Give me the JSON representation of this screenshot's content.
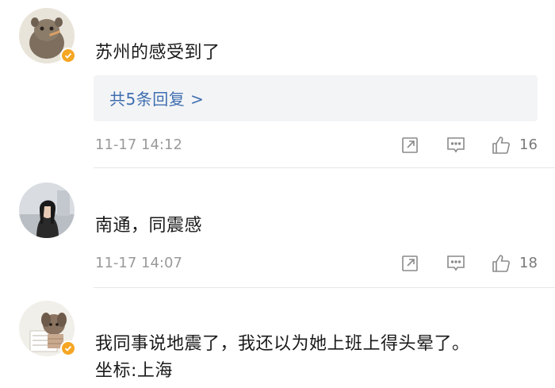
{
  "comments": [
    {
      "avatar_icon": "cartoon-animal-avatar",
      "verified_icon": "verified-badge-icon",
      "text": "苏州的感受到了",
      "reply_summary": "共5条回复 >",
      "time": "11-17 14:12",
      "likes": "16"
    },
    {
      "avatar_icon": "user-photo-avatar",
      "text": "南通，同震感",
      "time": "11-17 14:07",
      "likes": "18"
    },
    {
      "avatar_icon": "cartoon-dog-avatar",
      "verified_icon": "verified-badge-icon",
      "text_line1": "我同事说地震了，我还以为她上班上得头晕了。",
      "text_line2": "坐标:上海"
    }
  ],
  "colors": {
    "link": "#3f6fb0",
    "verified": "#f5a623",
    "meta": "#9a9a9a",
    "reply_bg": "#f3f4f6"
  }
}
